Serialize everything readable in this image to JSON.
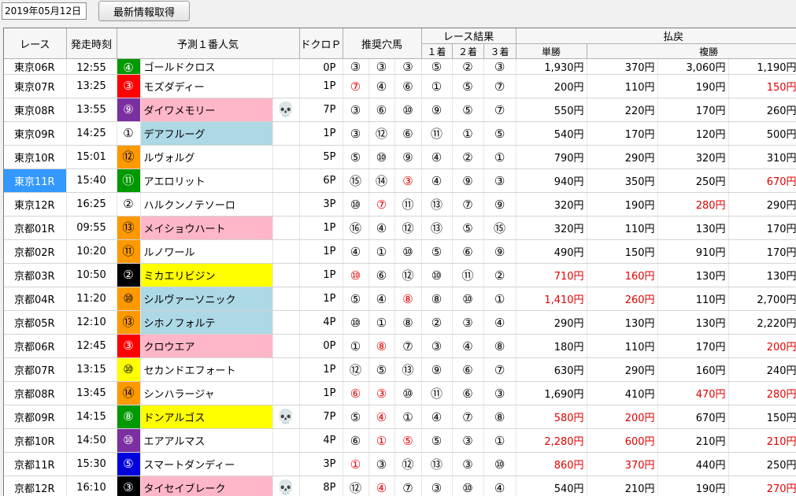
{
  "header": {
    "date": "2019年05月12日",
    "refresh_label": "最新情報取得"
  },
  "columns": {
    "race": "レース",
    "start_time": "発走時刻",
    "favorite": "予測１番人気",
    "dokuro": "ドクロＰ",
    "recommended": "推奨穴馬",
    "result": "レース結果",
    "first": "１着",
    "second": "２着",
    "third": "３着",
    "payout": "払戻",
    "win": "単勝",
    "place": "複勝"
  },
  "colors": {
    "pink": "#ffb6c8",
    "lightblue": "#add8e6",
    "yellow": "#ffff00",
    "red_text": "#e00000",
    "selected": "#3399ff"
  },
  "partial_row": {
    "race": "東京06R",
    "time": "12:55",
    "num": "④",
    "num_bg": "#009900",
    "num_color": "#ffffff",
    "name": "ゴールドクロス",
    "p": "0P",
    "rec": [
      "③",
      "③",
      "③"
    ],
    "res": [
      "⑤",
      "②",
      "③"
    ],
    "win": "1,930円",
    "p1": "370円",
    "p2": "3,060円",
    "p3": "1,190円"
  },
  "rows": [
    {
      "race": "東京07R",
      "time": "13:25",
      "num": "③",
      "num_bg": "#ff0000",
      "num_color": "#ffffff",
      "name": "モズダディー",
      "name_bg": "",
      "skull": false,
      "p": "1P",
      "rec": [
        "⑦",
        "④",
        "⑥"
      ],
      "rec_red": [
        true,
        false,
        false
      ],
      "res": [
        "①",
        "⑤",
        "⑦"
      ],
      "win": "200円",
      "win_red": false,
      "p1": "110円",
      "p1_red": false,
      "p2": "190円",
      "p2_red": false,
      "p3": "150円",
      "p3_red": true
    },
    {
      "race": "東京08R",
      "time": "13:55",
      "num": "⑨",
      "num_bg": "#7b2fa0",
      "num_color": "#ffffff",
      "name": "ダイワメモリー",
      "name_bg": "#ffb6c8",
      "skull": true,
      "p": "7P",
      "rec": [
        "③",
        "⑥",
        "⑩"
      ],
      "rec_red": [
        false,
        false,
        false
      ],
      "res": [
        "⑨",
        "⑤",
        "⑦"
      ],
      "win": "550円",
      "win_red": false,
      "p1": "220円",
      "p1_red": false,
      "p2": "170円",
      "p2_red": false,
      "p3": "260円",
      "p3_red": false
    },
    {
      "race": "東京09R",
      "time": "14:25",
      "num": "①",
      "num_bg": "#ffffff",
      "num_color": "#000000",
      "name": "デアフルーグ",
      "name_bg": "#add8e6",
      "skull": false,
      "p": "1P",
      "rec": [
        "③",
        "⑫",
        "⑥"
      ],
      "rec_red": [
        false,
        false,
        false
      ],
      "res": [
        "⑪",
        "①",
        "⑤"
      ],
      "win": "540円",
      "win_red": false,
      "p1": "170円",
      "p1_red": false,
      "p2": "120円",
      "p2_red": false,
      "p3": "500円",
      "p3_red": false
    },
    {
      "race": "東京10R",
      "time": "15:01",
      "num": "⑫",
      "num_bg": "#ff9900",
      "num_color": "#000000",
      "name": "ルヴォルグ",
      "name_bg": "",
      "skull": false,
      "p": "5P",
      "rec": [
        "⑤",
        "⑩",
        "⑨"
      ],
      "rec_red": [
        false,
        false,
        false
      ],
      "res": [
        "④",
        "②",
        "①"
      ],
      "win": "790円",
      "win_red": false,
      "p1": "290円",
      "p1_red": false,
      "p2": "320円",
      "p2_red": false,
      "p3": "310円",
      "p3_red": false
    },
    {
      "race": "東京11R",
      "time": "15:40",
      "num": "⑪",
      "num_bg": "#009900",
      "num_color": "#ffffff",
      "name": "アエロリット",
      "name_bg": "",
      "skull": false,
      "p": "6P",
      "rec": [
        "⑮",
        "⑭",
        "③"
      ],
      "rec_red": [
        false,
        false,
        true
      ],
      "res": [
        "④",
        "⑨",
        "③"
      ],
      "win": "940円",
      "win_red": false,
      "p1": "350円",
      "p1_red": false,
      "p2": "250円",
      "p2_red": false,
      "p3": "670円",
      "p3_red": true,
      "selected": true
    },
    {
      "race": "東京12R",
      "time": "16:25",
      "num": "②",
      "num_bg": "#ffffff",
      "num_color": "#000000",
      "name": "ハルクンノテソーロ",
      "name_bg": "",
      "skull": false,
      "p": "3P",
      "rec": [
        "⑩",
        "⑦",
        "⑪"
      ],
      "rec_red": [
        false,
        true,
        false
      ],
      "res": [
        "⑬",
        "⑦",
        "⑨"
      ],
      "win": "320円",
      "win_red": false,
      "p1": "190円",
      "p1_red": false,
      "p2": "280円",
      "p2_red": true,
      "p3": "290円",
      "p3_red": false
    },
    {
      "race": "京都01R",
      "time": "09:55",
      "num": "⑬",
      "num_bg": "#ff9900",
      "num_color": "#000000",
      "name": "メイショウハート",
      "name_bg": "#ffb6c8",
      "skull": false,
      "p": "1P",
      "rec": [
        "⑯",
        "④",
        "⑫"
      ],
      "rec_red": [
        false,
        false,
        false
      ],
      "res": [
        "⑬",
        "⑤",
        "⑮"
      ],
      "win": "320円",
      "win_red": false,
      "p1": "110円",
      "p1_red": false,
      "p2": "130円",
      "p2_red": false,
      "p3": "170円",
      "p3_red": false
    },
    {
      "race": "京都02R",
      "time": "10:20",
      "num": "⑪",
      "num_bg": "#ff9900",
      "num_color": "#000000",
      "name": "ルノワール",
      "name_bg": "",
      "skull": false,
      "p": "1P",
      "rec": [
        "④",
        "①",
        "⑩"
      ],
      "rec_red": [
        false,
        false,
        false
      ],
      "res": [
        "⑤",
        "⑥",
        "⑨"
      ],
      "win": "490円",
      "win_red": false,
      "p1": "150円",
      "p1_red": false,
      "p2": "910円",
      "p2_red": false,
      "p3": "170円",
      "p3_red": false
    },
    {
      "race": "京都03R",
      "time": "10:50",
      "num": "②",
      "num_bg": "#000000",
      "num_color": "#ffffff",
      "name": "ミカエリビジン",
      "name_bg": "#ffff00",
      "skull": false,
      "p": "1P",
      "rec": [
        "⑩",
        "⑥",
        "⑫"
      ],
      "rec_red": [
        true,
        false,
        false
      ],
      "res": [
        "⑩",
        "⑪",
        "②"
      ],
      "win": "710円",
      "win_red": true,
      "p1": "160円",
      "p1_red": true,
      "p2": "130円",
      "p2_red": false,
      "p3": "130円",
      "p3_red": false
    },
    {
      "race": "京都04R",
      "time": "11:20",
      "num": "⑩",
      "num_bg": "#ff9900",
      "num_color": "#000000",
      "name": "シルヴァーソニック",
      "name_bg": "#add8e6",
      "skull": false,
      "p": "1P",
      "rec": [
        "⑤",
        "④",
        "⑧"
      ],
      "rec_red": [
        false,
        false,
        true
      ],
      "res": [
        "⑧",
        "⑩",
        "①"
      ],
      "win": "1,410円",
      "win_red": true,
      "p1": "260円",
      "p1_red": true,
      "p2": "110円",
      "p2_red": false,
      "p3": "2,700円",
      "p3_red": false
    },
    {
      "race": "京都05R",
      "time": "12:10",
      "num": "⑬",
      "num_bg": "#ff9900",
      "num_color": "#000000",
      "name": "シホノフォルテ",
      "name_bg": "#add8e6",
      "skull": false,
      "p": "4P",
      "rec": [
        "⑩",
        "①",
        "⑧"
      ],
      "rec_red": [
        false,
        false,
        false
      ],
      "res": [
        "②",
        "③",
        "④"
      ],
      "win": "290円",
      "win_red": false,
      "p1": "130円",
      "p1_red": false,
      "p2": "130円",
      "p2_red": false,
      "p3": "2,220円",
      "p3_red": false
    },
    {
      "race": "京都06R",
      "time": "12:45",
      "num": "③",
      "num_bg": "#ff0000",
      "num_color": "#ffffff",
      "name": "クロウエア",
      "name_bg": "#ffb6c8",
      "skull": false,
      "p": "0P",
      "rec": [
        "①",
        "⑧",
        "⑦"
      ],
      "rec_red": [
        false,
        true,
        false
      ],
      "res": [
        "③",
        "④",
        "⑧"
      ],
      "win": "180円",
      "win_red": false,
      "p1": "110円",
      "p1_red": false,
      "p2": "170円",
      "p2_red": false,
      "p3": "200円",
      "p3_red": true
    },
    {
      "race": "京都07R",
      "time": "13:15",
      "num": "⑩",
      "num_bg": "#ffff00",
      "num_color": "#000000",
      "name": "セカンドエフォート",
      "name_bg": "",
      "skull": false,
      "p": "1P",
      "rec": [
        "⑫",
        "⑤",
        "⑬"
      ],
      "rec_red": [
        false,
        false,
        false
      ],
      "res": [
        "⑨",
        "⑥",
        "⑦"
      ],
      "win": "630円",
      "win_red": false,
      "p1": "290円",
      "p1_red": false,
      "p2": "160円",
      "p2_red": false,
      "p3": "240円",
      "p3_red": false
    },
    {
      "race": "京都08R",
      "time": "13:45",
      "num": "⑭",
      "num_bg": "#ff9900",
      "num_color": "#000000",
      "name": "シンハラージャ",
      "name_bg": "",
      "skull": false,
      "p": "1P",
      "rec": [
        "⑥",
        "③",
        "⑩"
      ],
      "rec_red": [
        true,
        true,
        false
      ],
      "res": [
        "⑪",
        "⑥",
        "③"
      ],
      "win": "1,690円",
      "win_red": false,
      "p1": "410円",
      "p1_red": false,
      "p2": "470円",
      "p2_red": true,
      "p3": "280円",
      "p3_red": true
    },
    {
      "race": "京都09R",
      "time": "14:15",
      "num": "⑧",
      "num_bg": "#009900",
      "num_color": "#ffffff",
      "name": "ドンアルゴス",
      "name_bg": "#ffff00",
      "skull": true,
      "p": "7P",
      "rec": [
        "⑤",
        "④",
        "①"
      ],
      "rec_red": [
        false,
        true,
        false
      ],
      "res": [
        "④",
        "⑦",
        "⑧"
      ],
      "win": "580円",
      "win_red": true,
      "p1": "200円",
      "p1_red": true,
      "p2": "670円",
      "p2_red": false,
      "p3": "150円",
      "p3_red": false
    },
    {
      "race": "京都10R",
      "time": "14:50",
      "num": "⑩",
      "num_bg": "#7b2fa0",
      "num_color": "#ffffff",
      "name": "エアアルマス",
      "name_bg": "",
      "skull": false,
      "p": "4P",
      "rec": [
        "⑥",
        "①",
        "⑤"
      ],
      "rec_red": [
        false,
        true,
        true
      ],
      "res": [
        "⑤",
        "③",
        "①"
      ],
      "win": "2,280円",
      "win_red": true,
      "p1": "600円",
      "p1_red": true,
      "p2": "210円",
      "p2_red": false,
      "p3": "210円",
      "p3_red": true
    },
    {
      "race": "京都11R",
      "time": "15:30",
      "num": "⑤",
      "num_bg": "#0000dd",
      "num_color": "#ffffff",
      "name": "スマートダンディー",
      "name_bg": "",
      "skull": false,
      "p": "3P",
      "rec": [
        "①",
        "③",
        "⑫"
      ],
      "rec_red": [
        true,
        false,
        false
      ],
      "res": [
        "⑬",
        "③",
        "⑩"
      ],
      "win": "860円",
      "win_red": true,
      "p1": "370円",
      "p1_red": true,
      "p2": "440円",
      "p2_red": false,
      "p3": "250円",
      "p3_red": false
    },
    {
      "race": "京都12R",
      "time": "16:10",
      "num": "③",
      "num_bg": "#000000",
      "num_color": "#ffffff",
      "name": "タイセイブレーク",
      "name_bg": "#ffb6c8",
      "skull": true,
      "p": "8P",
      "rec": [
        "⑫",
        "④",
        "⑦"
      ],
      "rec_red": [
        false,
        true,
        false
      ],
      "res": [
        "③",
        "⑩",
        "④"
      ],
      "win": "540円",
      "win_red": false,
      "p1": "210円",
      "p1_red": false,
      "p2": "190円",
      "p2_red": false,
      "p3": "270円",
      "p3_red": true
    }
  ]
}
